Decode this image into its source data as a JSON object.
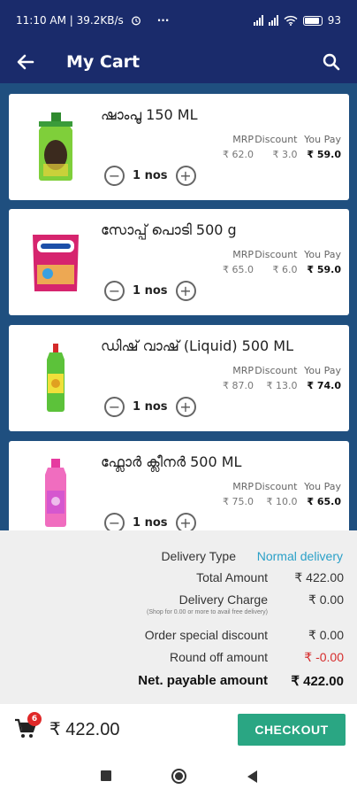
{
  "status_bar": {
    "time_speed": "11:10 AM | 39.2KB/s",
    "dots": "···",
    "battery": "93",
    "battery_level": 0.93
  },
  "app_bar": {
    "title": "My Cart",
    "back_icon": "arrow-back-icon",
    "search_icon": "search-icon"
  },
  "price_headers": {
    "mrp": "MRP",
    "discount": "Discount",
    "you_pay": "You Pay"
  },
  "items": [
    {
      "name": "ഷാംപൂ 150 ML",
      "mrp": "₹ 62.0",
      "discount": "₹ 3.0",
      "you_pay": "₹ 59.0",
      "qty": "1 nos"
    },
    {
      "name": "സോപ്പ് പൊടി 500 g",
      "mrp": "₹ 65.0",
      "discount": "₹ 6.0",
      "you_pay": "₹ 59.0",
      "qty": "1 nos"
    },
    {
      "name": "ഡിഷ് വാഷ് (Liquid) 500 ML",
      "mrp": "₹ 87.0",
      "discount": "₹ 13.0",
      "you_pay": "₹ 74.0",
      "qty": "1 nos"
    },
    {
      "name": "ഫ്ലോർ ക്ലീനർ 500 ML",
      "mrp": "₹ 75.0",
      "discount": "₹ 10.0",
      "you_pay": "₹ 65.0",
      "qty": "1 nos"
    }
  ],
  "summary": {
    "delivery_type_label": "Delivery Type",
    "delivery_type_value": "Normal delivery",
    "total_amount_label": "Total Amount",
    "total_amount_value": "₹ 422.00",
    "delivery_charge_label": "Delivery Charge",
    "delivery_charge_value": "₹ 0.00",
    "delivery_note": "(Shop for 0.00 or more to avail free delivery)",
    "special_discount_label": "Order special discount",
    "special_discount_value": "₹ 0.00",
    "round_off_label": "Round off amount",
    "round_off_value": "₹ -0.00",
    "net_payable_label": "Net. payable amount",
    "net_payable_value": "₹ 422.00"
  },
  "bottom_bar": {
    "cart_count": "6",
    "total": "₹ 422.00",
    "checkout_label": "CHECKOUT"
  },
  "colors": {
    "app_bar": "#1a2b6b",
    "list_bg": "#1f4f7f",
    "checkout": "#2aa683",
    "delivery_link": "#2aa0c8",
    "negative": "#d62c2c"
  }
}
